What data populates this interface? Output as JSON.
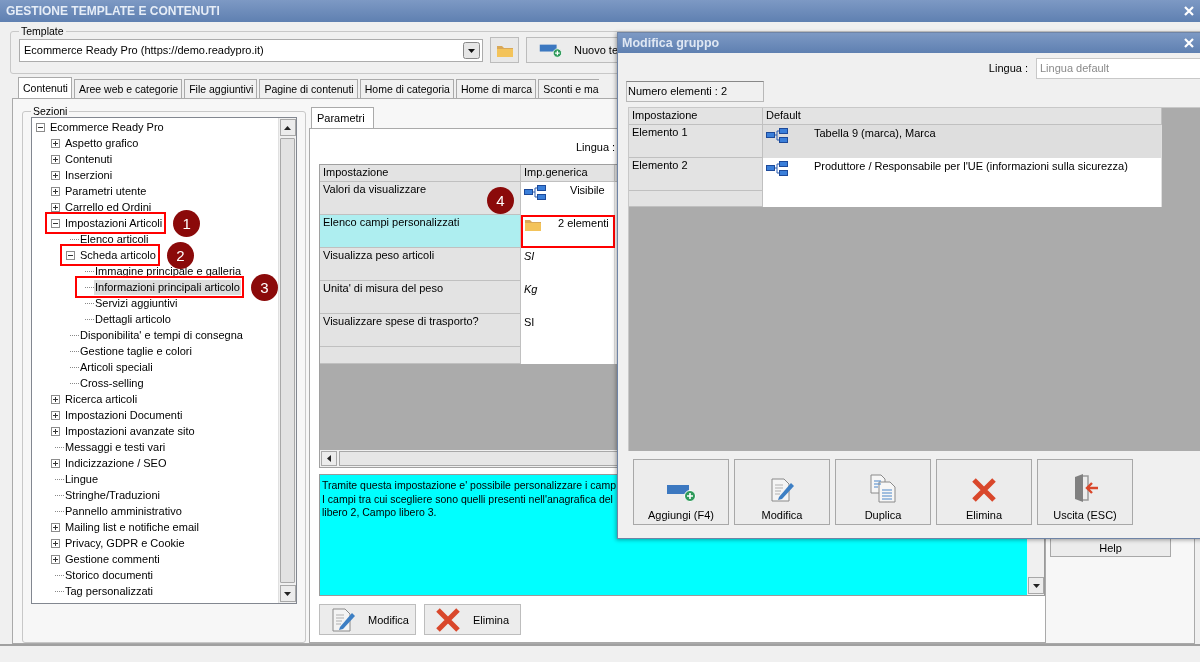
{
  "window": {
    "title": "GESTIONE TEMPLATE E CONTENUTI"
  },
  "template": {
    "legend": "Template",
    "value": "Ecommerce Ready Pro (https://demo.readypro.it)",
    "new_button": "Nuovo te"
  },
  "tabs": [
    {
      "label": "Contenuti",
      "selected": true
    },
    {
      "label": "Aree web e categorie",
      "selected": false
    },
    {
      "label": "File aggiuntivi",
      "selected": false
    },
    {
      "label": "Pagine di contenuti",
      "selected": false
    },
    {
      "label": "Home di categoria",
      "selected": false
    },
    {
      "label": "Home di marca",
      "selected": false
    },
    {
      "label": "Sconti e ma",
      "selected": false
    }
  ],
  "sections": {
    "legend": "Sezioni",
    "tree": [
      {
        "label": "Ecommerce Ready Pro",
        "expanded": true,
        "selected": false,
        "children": [
          {
            "label": "Aspetto grafico",
            "expanded": false,
            "selected": false
          },
          {
            "label": "Contenuti",
            "expanded": false,
            "selected": false
          },
          {
            "label": "Inserzioni",
            "expanded": false,
            "selected": false
          },
          {
            "label": "Parametri utente",
            "expanded": false,
            "selected": false
          },
          {
            "label": "Carrello ed Ordini",
            "expanded": false,
            "selected": false
          },
          {
            "label": "Impostazioni Articoli",
            "expanded": true,
            "selected": false,
            "annotation": "1",
            "children": [
              {
                "label": "Elenco articoli",
                "selected": false
              },
              {
                "label": "Scheda articolo",
                "expanded": true,
                "selected": false,
                "annotation": "2",
                "children": [
                  {
                    "label": "Immagine principale e galleria",
                    "selected": false
                  },
                  {
                    "label": "Informazioni principali articolo",
                    "selected": true,
                    "annotation": "3"
                  },
                  {
                    "label": "Servizi aggiuntivi",
                    "selected": false
                  },
                  {
                    "label": "Dettagli articolo",
                    "selected": false
                  }
                ]
              },
              {
                "label": "Disponibilita' e tempi di consegna",
                "selected": false
              },
              {
                "label": "Gestione taglie e colori",
                "selected": false
              },
              {
                "label": "Articoli speciali",
                "selected": false
              },
              {
                "label": "Cross-selling",
                "selected": false
              }
            ]
          },
          {
            "label": "Ricerca articoli",
            "expanded": false,
            "selected": false
          },
          {
            "label": "Impostazioni Documenti",
            "expanded": false,
            "selected": false
          },
          {
            "label": "Impostazioni avanzate sito",
            "expanded": false,
            "selected": false
          },
          {
            "label": "Messaggi e testi vari",
            "selected": false
          },
          {
            "label": "Indicizzazione / SEO",
            "expanded": false,
            "selected": false
          },
          {
            "label": "Lingue",
            "selected": false
          },
          {
            "label": "Stringhe/Traduzioni",
            "selected": false
          },
          {
            "label": "Pannello amministrativo",
            "selected": false
          },
          {
            "label": "Mailing list e notifiche email",
            "expanded": false,
            "selected": false
          },
          {
            "label": "Privacy, GDPR e Cookie",
            "expanded": false,
            "selected": false
          },
          {
            "label": "Gestione commenti",
            "expanded": false,
            "selected": false
          },
          {
            "label": "Storico documenti",
            "selected": false
          },
          {
            "label": "Tag personalizzati",
            "selected": false
          }
        ]
      }
    ]
  },
  "parameters": {
    "tab": "Parametri",
    "language_label": "Lingua :",
    "columns": [
      "Impostazione",
      "Imp.generica"
    ],
    "rows": [
      {
        "name": "Valori da visualizzare",
        "value": "Visibile",
        "kind": "list",
        "selected": false
      },
      {
        "name": "Elenco campi personalizzati",
        "value": "2 elementi",
        "kind": "group",
        "selected": true,
        "annotation": "4"
      },
      {
        "name": "Visualizza peso articoli",
        "value": "SI",
        "kind": "inherited",
        "selected": false
      },
      {
        "name": "Unita' di misura del peso",
        "value": "Kg",
        "kind": "inherited",
        "selected": false
      },
      {
        "name": "Visualizzare spese di trasporto?",
        "value": "SI",
        "kind": "plain",
        "selected": false
      }
    ],
    "description": [
      "Tramite questa impostazione e' possibile personalizzare i camp",
      "I campi tra cui scegliere sono quelli presenti nell'anagrafica del",
      "libero 2, Campo libero 3."
    ],
    "buttons": [
      {
        "label": "Modifica",
        "kind": "edit"
      },
      {
        "label": "Elimina",
        "kind": "delete"
      }
    ]
  },
  "help_button": "Help",
  "dialog": {
    "title": "Modifica gruppo",
    "language_label": "Lingua :",
    "language_placeholder": "Lingua default",
    "count": "Numero elementi : 2",
    "columns": [
      "Impostazione",
      "Default"
    ],
    "rows": [
      {
        "name": "Elemento 1",
        "value": "Tabella 9 (marca), Marca",
        "selected": true
      },
      {
        "name": "Elemento 2",
        "value": "Produttore / Responsabile per l'UE (informazioni sulla sicurezza)",
        "selected": false
      }
    ],
    "buttons": [
      {
        "label": "Aggiungi (F4)",
        "kind": "add"
      },
      {
        "label": "Modifica",
        "kind": "edit"
      },
      {
        "label": "Duplica",
        "kind": "duplicate"
      },
      {
        "label": "Elimina",
        "kind": "delete"
      },
      {
        "label": "Uscita (ESC)",
        "kind": "exit"
      }
    ]
  }
}
